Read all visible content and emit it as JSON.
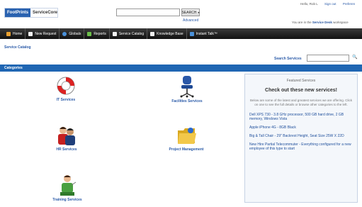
{
  "header": {
    "logo_brand": "FootPrints",
    "logo_product": "ServiceCore",
    "search_button": "SEARCH",
    "advanced_link": "Advanced",
    "greeting": "Hello, Rob L",
    "sign_out": "Sign out",
    "preferences": "Preferen",
    "workspace_prefix": "You are in the",
    "workspace_name": "Service Desk",
    "workspace_suffix": "workspace"
  },
  "nav": {
    "items": [
      {
        "label": "Home",
        "icon": "home-icon",
        "color": "#e8a030"
      },
      {
        "label": "New Request",
        "icon": "new-request-icon",
        "color": "#f0f0f0"
      },
      {
        "label": "Globals",
        "icon": "globals-icon",
        "color": "#4a90d9"
      },
      {
        "label": "Reports",
        "icon": "reports-icon",
        "color": "#6cbf4a"
      },
      {
        "label": "Service Catalog",
        "icon": "service-catalog-icon",
        "color": "#f0f0f0"
      },
      {
        "label": "Knowledge Base",
        "icon": "knowledge-base-icon",
        "color": "#f0f0f0"
      },
      {
        "label": "Instant Talk™",
        "icon": "instant-talk-icon",
        "color": "#4a90d9"
      }
    ]
  },
  "page": {
    "breadcrumb": "Service Catalog",
    "search_services_label": "Search Services",
    "categories_header": "Categories"
  },
  "categories": [
    {
      "label": "IT Services",
      "icon": "lifebuoy-icon"
    },
    {
      "label": "Facilities Services",
      "icon": "office-chair-icon"
    },
    {
      "label": "HR Services",
      "icon": "people-icon"
    },
    {
      "label": "Project Management",
      "icon": "folder-icon"
    },
    {
      "label": "Training Services",
      "icon": "trainer-icon"
    }
  ],
  "featured": {
    "header": "Featured Services",
    "title": "Check out these new services!",
    "description": "Below are some of the latest and greatest services we are offering. Click on one to see the full details or browse other categories to the left.",
    "items": [
      "Dell XPS 730 - 3.8 GHz processor, 500 GB hard drive, 2 GB memory, Windows Vista",
      "Apple iPhone 4G - 8GB Black",
      "Big & Tall Chair - 29\" Backrest Height, Seat Size 25W X 22D",
      "New Hire Partial Telecommuter - Everything configured for a new employee of this type to start"
    ]
  },
  "colors": {
    "accent_blue": "#1f66b3",
    "link_blue": "#2a5aa8",
    "navbar": "#1a1a1a"
  }
}
